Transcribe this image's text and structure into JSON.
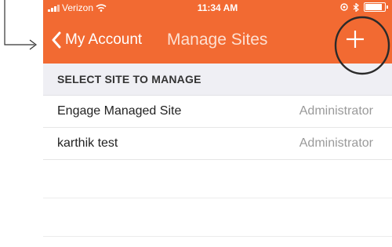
{
  "status_bar": {
    "carrier": "Verizon",
    "time": "11:34 AM"
  },
  "nav": {
    "back_label": "My Account",
    "title": "Manage Sites",
    "add_symbol": "+"
  },
  "section": {
    "header": "SELECT SITE TO MANAGE"
  },
  "sites": [
    {
      "name": "Engage Managed Site",
      "role": "Administrator"
    },
    {
      "name": "karthik test",
      "role": "Administrator"
    }
  ],
  "colors": {
    "accent": "#f26a32",
    "section_bg": "#efeff4"
  },
  "icons": [
    "signal-icon",
    "wifi-icon",
    "location-icon",
    "bluetooth-icon",
    "battery-icon",
    "back-chevron-icon",
    "plus-icon",
    "annotation-arrow-icon",
    "annotation-circle"
  ]
}
